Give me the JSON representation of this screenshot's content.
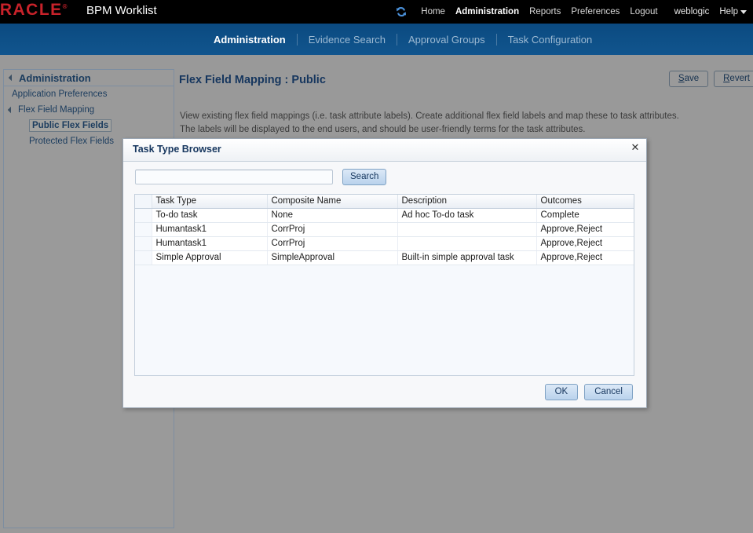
{
  "branding": {
    "logo_text": "ORACLE",
    "app_title": "BPM Worklist"
  },
  "global_nav": {
    "refresh_icon": "refresh-icon",
    "items": [
      {
        "label": "Home",
        "active": false
      },
      {
        "label": "Administration",
        "active": true
      },
      {
        "label": "Reports",
        "active": false
      },
      {
        "label": "Preferences",
        "active": false
      },
      {
        "label": "Logout",
        "active": false
      }
    ],
    "user": "weblogic",
    "help_label": "Help",
    "help_caret_icon": "chevron-down-icon"
  },
  "sub_nav": {
    "items": [
      {
        "label": "Administration",
        "active": true
      },
      {
        "label": "Evidence Search",
        "active": false
      },
      {
        "label": "Approval Groups",
        "active": false
      },
      {
        "label": "Task Configuration",
        "active": false
      }
    ]
  },
  "sidebar": {
    "header": "Administration",
    "items": [
      {
        "label": "Application Preferences",
        "level": 2,
        "expandable": false,
        "selected": false
      },
      {
        "label": "Flex Field Mapping",
        "level": 2,
        "expandable": true,
        "selected": false
      },
      {
        "label": "Public Flex Fields",
        "level": 3,
        "expandable": false,
        "selected": true
      },
      {
        "label": "Protected Flex Fields",
        "level": 3,
        "expandable": false,
        "selected": false
      }
    ]
  },
  "main": {
    "title": "Flex Field Mapping : Public",
    "save_label": "Save",
    "save_mnemonic": "S",
    "save_rest": "ave",
    "revert_label": "Revert",
    "revert_mnemonic": "R",
    "revert_rest": "evert",
    "description_line1": "View existing flex field mappings (i.e. task attribute labels). Create additional flex field labels and map these to task attributes.",
    "description_line2": "The labels will be displayed to the end users, and should be user-friendly terms for the task attributes."
  },
  "dialog": {
    "title": "Task Type Browser",
    "close_icon": "close-icon",
    "search": {
      "value": "",
      "placeholder": "",
      "button_label": "Search"
    },
    "table": {
      "columns": [
        "",
        "Task Type",
        "Composite Name",
        "Description",
        "Outcomes"
      ],
      "rows": [
        {
          "task_type": "To-do task",
          "composite_name": "None",
          "description": "Ad hoc To-do task",
          "outcomes": "Complete"
        },
        {
          "task_type": "Humantask1",
          "composite_name": "CorrProj",
          "description": "",
          "outcomes": "Approve,Reject"
        },
        {
          "task_type": "Humantask1",
          "composite_name": "CorrProj",
          "description": "",
          "outcomes": "Approve,Reject"
        },
        {
          "task_type": "Simple Approval",
          "composite_name": "SimpleApproval",
          "description": "Built-in simple approval task",
          "outcomes": "Approve,Reject"
        }
      ]
    },
    "ok_label": "OK",
    "cancel_label": "Cancel"
  },
  "colors": {
    "brand_red": "#c8222a",
    "nav_blue": "#0f5086",
    "top_black": "#000000",
    "page_grey": "#999999",
    "link_blue": "#16365e"
  }
}
